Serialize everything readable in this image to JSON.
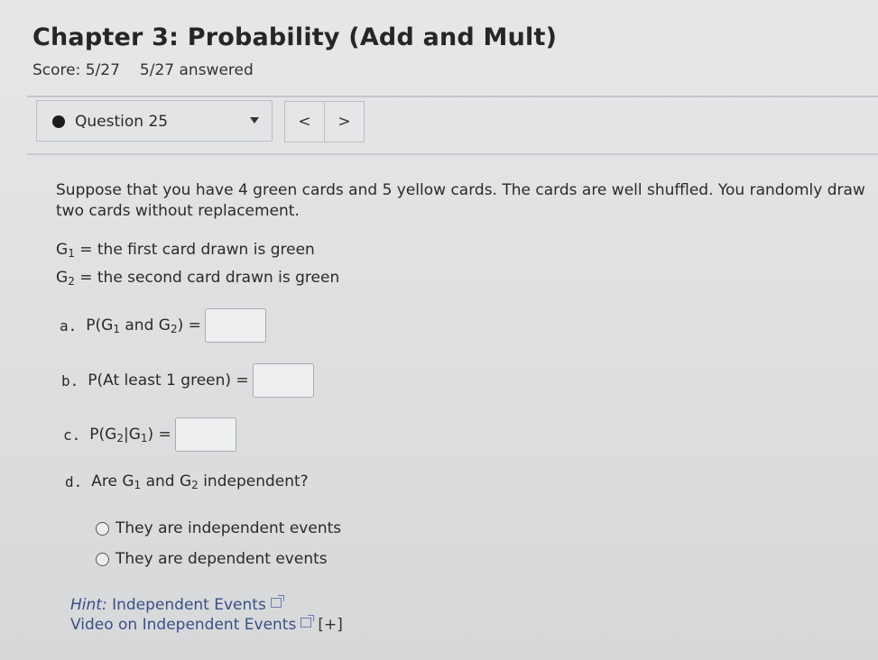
{
  "header": {
    "title": "Chapter 3: Probability (Add and Mult)",
    "score": "Score: 5/27",
    "answered": "5/27 answered"
  },
  "question_nav": {
    "current": "Question 25",
    "prev_label": "<",
    "next_label": ">"
  },
  "problem": {
    "intro": "Suppose that you have 4 green cards and 5 yellow cards. The cards are well shuffled. You randomly draw two cards without replacement.",
    "def1_text": " = the first card drawn is green",
    "def2_text": " = the second card drawn is green",
    "parts": {
      "a": {
        "letter": "a.",
        "prefix": "P(G",
        "mid": " and G",
        "suffix": ") ="
      },
      "b": {
        "letter": "b.",
        "text": "P(At least 1 green) ="
      },
      "c": {
        "letter": "c.",
        "prefix": "P(G",
        "mid": "|G",
        "suffix": ") ="
      },
      "d": {
        "letter": "d.",
        "prefix": "Are G",
        "mid": " and G",
        "suffix": " independent?"
      }
    },
    "options": [
      {
        "label": "They are independent events",
        "selected": false
      },
      {
        "label": "They are dependent events",
        "selected": false
      }
    ]
  },
  "subscripts": {
    "one": "1",
    "two": "2",
    "G": "G"
  },
  "hints": {
    "hint_label": "Hint:",
    "hint_link": "Independent Events",
    "video_link": "Video on Independent Events",
    "expand": "[+]"
  },
  "icons": {
    "question_status": "filled-circle-icon",
    "dropdown": "caret-down-icon",
    "external_link": "external-link-icon"
  }
}
